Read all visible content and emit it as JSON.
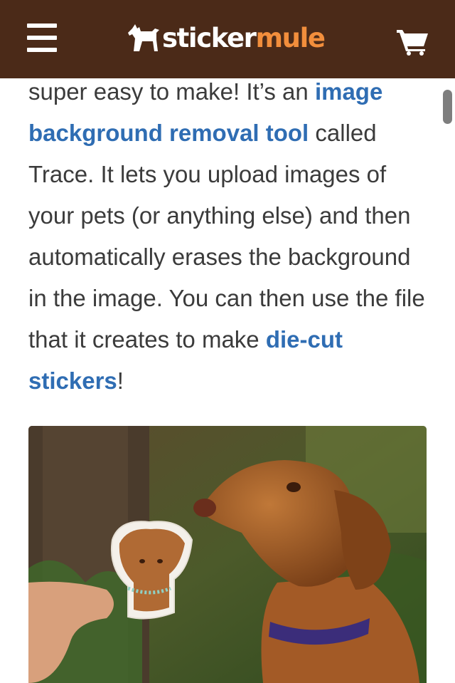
{
  "header": {
    "logo_sticker": "sticker",
    "logo_mule": "mule",
    "icons": {
      "menu": "hamburger-menu-icon",
      "logo": "mule-logo-icon",
      "cart": "shopping-cart-icon"
    }
  },
  "colors": {
    "header_bg": "#4b2a18",
    "brand_orange": "#f28e3c",
    "link": "#2f6db3",
    "body_text": "#3b3b3b"
  },
  "article": {
    "text_1": "super easy to make! It’s an ",
    "link_1": "image background removal tool",
    "text_2": " called Trace. It lets you upload images of your pets (or anything else) and then automatically erases the background in the image. You can then use the file that it creates to make ",
    "link_2": "die-cut stickers",
    "text_3": "!"
  },
  "image": {
    "subject": "photo of a vizsla dog sniffing a die-cut sticker of itself held in a hand"
  }
}
